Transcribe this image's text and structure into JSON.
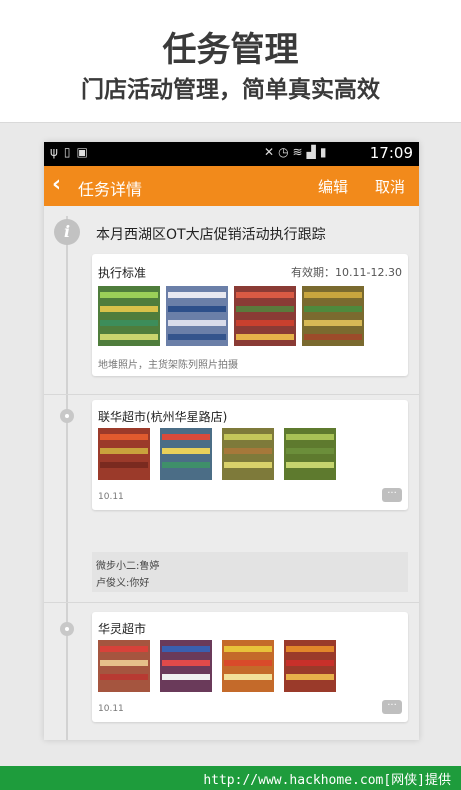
{
  "promo": {
    "title": "任务管理",
    "subtitle": "门店活动管理，简单真实高效"
  },
  "status_bar": {
    "left_icons": [
      "usb-icon",
      "sim-icon",
      "image-icon"
    ],
    "right_icons": [
      "mute-icon",
      "alarm-icon",
      "wifi-icon",
      "signal-icon",
      "battery-icon"
    ],
    "time": "17:09"
  },
  "app_bar": {
    "back_icon": "chevron-left-icon",
    "title": "任务详情",
    "edit_label": "编辑",
    "cancel_label": "取消",
    "color": "#f28a1b"
  },
  "task": {
    "title": "本月西湖区OT大店促销活动执行跟踪",
    "standard": {
      "label": "执行标准",
      "validity": "有效期：10.11-12.30",
      "note": "地堆照片，主货架陈列照片拍摄",
      "photo_count": 4
    }
  },
  "stores": [
    {
      "name": "联华超市(杭州华星路店)",
      "date": "10.11",
      "photo_count": 4,
      "comments": [
        {
          "author": "微步小二:",
          "text": "鲁婷"
        },
        {
          "author": "卢俊义:",
          "text": "你好"
        }
      ]
    },
    {
      "name": "华灵超市",
      "date": "10.11",
      "photo_count": 4,
      "comments": []
    }
  ],
  "footer": {
    "text": "http://www.hackhome.com[网侠]提供"
  }
}
